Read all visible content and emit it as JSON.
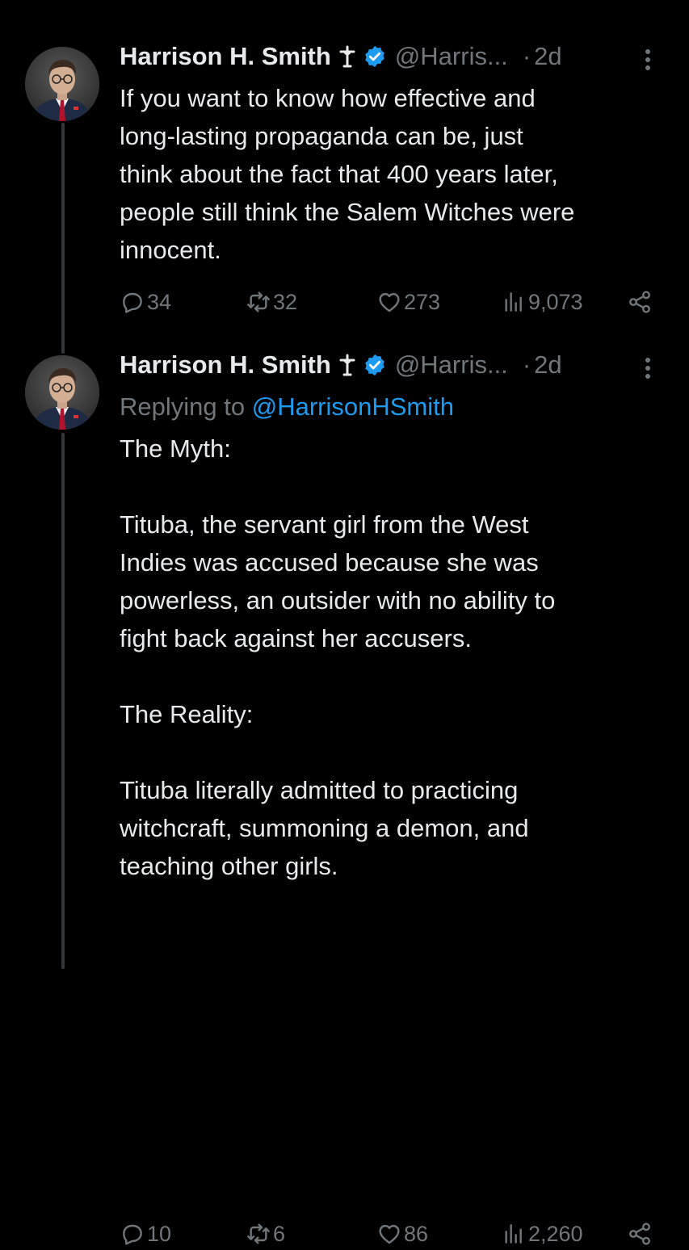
{
  "colors": {
    "background": "#000000",
    "text_primary": "#e7e9ea",
    "text_secondary": "#71767b",
    "accent": "#1d9bf0",
    "thread_line": "#333639"
  },
  "tweets": [
    {
      "display_name": "Harrison H. Smith",
      "name_icons": [
        "cross-icon",
        "verified-icon"
      ],
      "handle": "@Harris...",
      "dot": "·",
      "time": "2d",
      "body": "If you want to know how effective and\nlong-lasting propaganda can be, just\nthink about the fact that 400 years later,\npeople still think the Salem Witches were\ninnocent.",
      "stats": {
        "replies": "34",
        "reposts": "32",
        "likes": "273",
        "views": "9,073"
      }
    },
    {
      "display_name": "Harrison H. Smith",
      "name_icons": [
        "cross-icon",
        "verified-icon"
      ],
      "handle": "@Harris...",
      "dot": "·",
      "time": "2d",
      "replying_prefix": "Replying to ",
      "replying_mention": "@HarrisonHSmith",
      "body": "The Myth:\n\nTituba, the servant girl from the West\nIndies was accused because she was\npowerless, an outsider with no ability to\nfight back against her accusers.\n\nThe Reality:\n\nTituba literally admitted to practicing\nwitchcraft, summoning a demon, and\nteaching other girls.",
      "stats": {
        "replies": "10",
        "reposts": "6",
        "likes": "86",
        "views": "2,260"
      }
    }
  ]
}
